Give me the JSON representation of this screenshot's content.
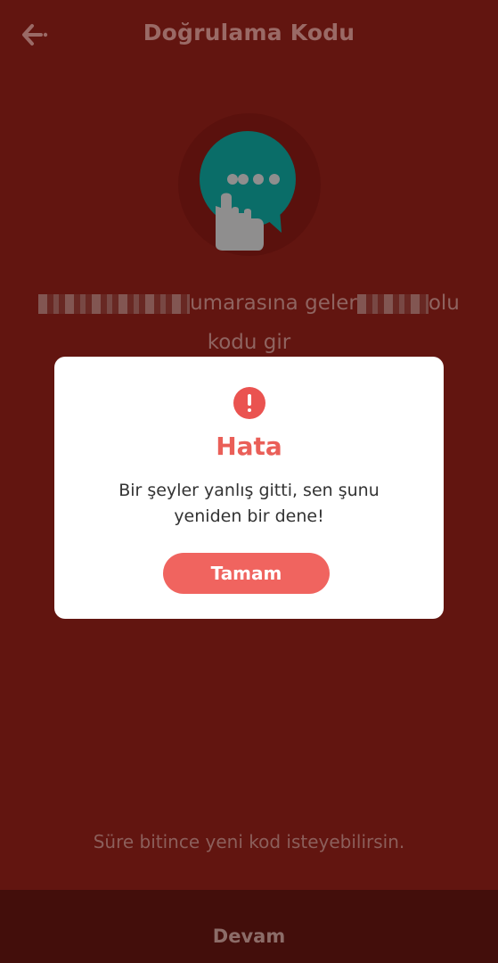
{
  "header": {
    "title": "Doğrulama Kodu",
    "back_icon": "arrow-left-icon"
  },
  "illustration": {
    "icon": "chat-bubble-touch-icon"
  },
  "instruction": {
    "part1": "umarasına geler",
    "part2": "olu",
    "line2": "kodu gir"
  },
  "timer_text": "Süre bitince yeni kod isteyebilirsin.",
  "bottom_button": {
    "label": "Devam"
  },
  "dialog": {
    "icon": "alert-circle-icon",
    "title": "Hata",
    "message_line1": "Bir şeyler yanlış gitti, sen şunu",
    "message_line2": "yeniden bir dene!",
    "ok_label": "Tamam",
    "accent_color": "#f0645f"
  },
  "colors": {
    "backdrop": "#621510",
    "teal": "#0a6d68"
  }
}
